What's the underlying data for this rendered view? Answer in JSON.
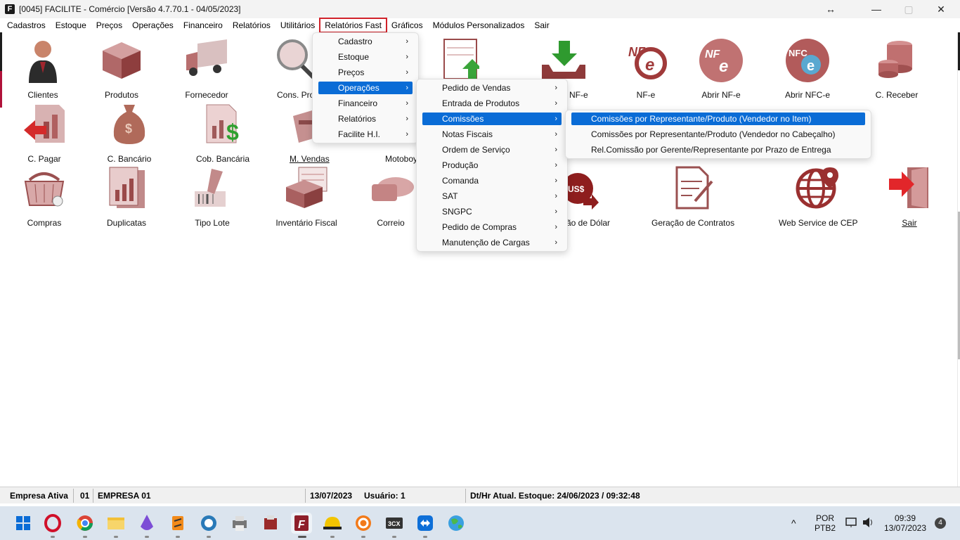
{
  "window": {
    "title": "[0045] FACILITE - Comércio [Versão 4.7.70.1 - 04/05/2023]",
    "app_icon": "F",
    "controls": {
      "resize": "↔",
      "minimize": "—",
      "maximize": "▢",
      "close": "✕"
    }
  },
  "menubar": [
    "Cadastros",
    "Estoque",
    "Preços",
    "Operações",
    "Financeiro",
    "Relatórios",
    "Utilitários",
    "Relatórios Fast",
    "Gráficos",
    "Módulos Personalizados",
    "Sair"
  ],
  "icons": [
    {
      "label": "Clientes",
      "icon": "person-icon"
    },
    {
      "label": "Produtos",
      "icon": "box-icon"
    },
    {
      "label": "Fornecedor",
      "icon": "truck-icon"
    },
    {
      "label": "Cons. Prod",
      "icon": "magnifier-icon"
    },
    {
      "label": "NF-e",
      "icon": "download-tray-icon"
    },
    {
      "label": "NF-e",
      "icon": "nfe-icon"
    },
    {
      "label": "Abrir NF-e",
      "icon": "nfe-circle-icon"
    },
    {
      "label": "Abrir NFC-e",
      "icon": "nfce-icon"
    },
    {
      "label": "C. Receber",
      "icon": "coins-icon"
    },
    {
      "label": "C. Pagar",
      "icon": "arrow-chart-icon"
    },
    {
      "label": "C. Bancário",
      "icon": "money-bag-icon"
    },
    {
      "label": "Cob. Bancária",
      "icon": "dollar-doc-icon"
    },
    {
      "label": "M. Vendas",
      "icon": "register-icon"
    },
    {
      "label": "Motoboy",
      "icon": "motoboy-icon"
    },
    {
      "label": "Compras",
      "icon": "basket-icon"
    },
    {
      "label": "Duplicatas",
      "icon": "duplicate-doc-icon"
    },
    {
      "label": "Tipo Lote",
      "icon": "barcode-scanner-icon"
    },
    {
      "label": "Inventário Fiscal",
      "icon": "inventory-icon"
    },
    {
      "label": "Correio",
      "icon": "mail-icon"
    },
    {
      "label": "ão de Dólar",
      "icon": "dollar-coin-icon"
    },
    {
      "label": "Geração de Contratos",
      "icon": "contract-icon"
    },
    {
      "label": "Web Service de CEP",
      "icon": "globe-icon"
    },
    {
      "label": "Sair",
      "icon": "exit-door-icon"
    }
  ],
  "menu_relatorios_fast": [
    "Cadastro",
    "Estoque",
    "Preços",
    "Operações",
    "Financeiro",
    "Relatórios",
    "Facilite H.I."
  ],
  "menu_operacoes": [
    "Pedido de Vendas",
    "Entrada de Produtos",
    "Comissões",
    "Notas Fiscais",
    "Ordem de Serviço",
    "Produção",
    "Comanda",
    "SAT",
    "SNGPC",
    "Pedido de Compras",
    "Manutenção de Cargas"
  ],
  "menu_comissoes": [
    "Comissões por Representante/Produto (Vendedor no Item)",
    "Comissões por Representante/Produto (Vendedor no Cabeçalho)",
    "Rel.Comissão por Gerente/Representante por Prazo de Entrega"
  ],
  "arrow": "›",
  "status": {
    "empresa_label": "Empresa Ativa",
    "empresa_code": "01",
    "empresa_name": "EMPRESA 01",
    "date": "13/07/2023",
    "user": "Usuário: 1",
    "stock": "Dt/Hr Atual. Estoque: 24/06/2023 / 09:32:48"
  },
  "taskbar": {
    "apps": [
      "windows-start-icon",
      "opera-icon",
      "chrome-icon",
      "file-explorer-icon",
      "app-purple-icon",
      "sublime-icon",
      "browser-icon",
      "printer-icon",
      "app-red-icon",
      "facilite-icon",
      "helmet-icon",
      "sync-icon",
      "3cx-icon",
      "teamviewer-icon",
      "globe-app-icon"
    ],
    "label_3cx": "3CX",
    "lang1": "POR",
    "lang2": "PTB2",
    "time": "09:39",
    "date": "13/07/2023",
    "notifications": "4"
  },
  "colors": {
    "accent": "#0a6cd6",
    "icon_maroon": "#8e2d2d",
    "highlight_box": "#d1222a",
    "taskbar": "#dbe4ee"
  }
}
